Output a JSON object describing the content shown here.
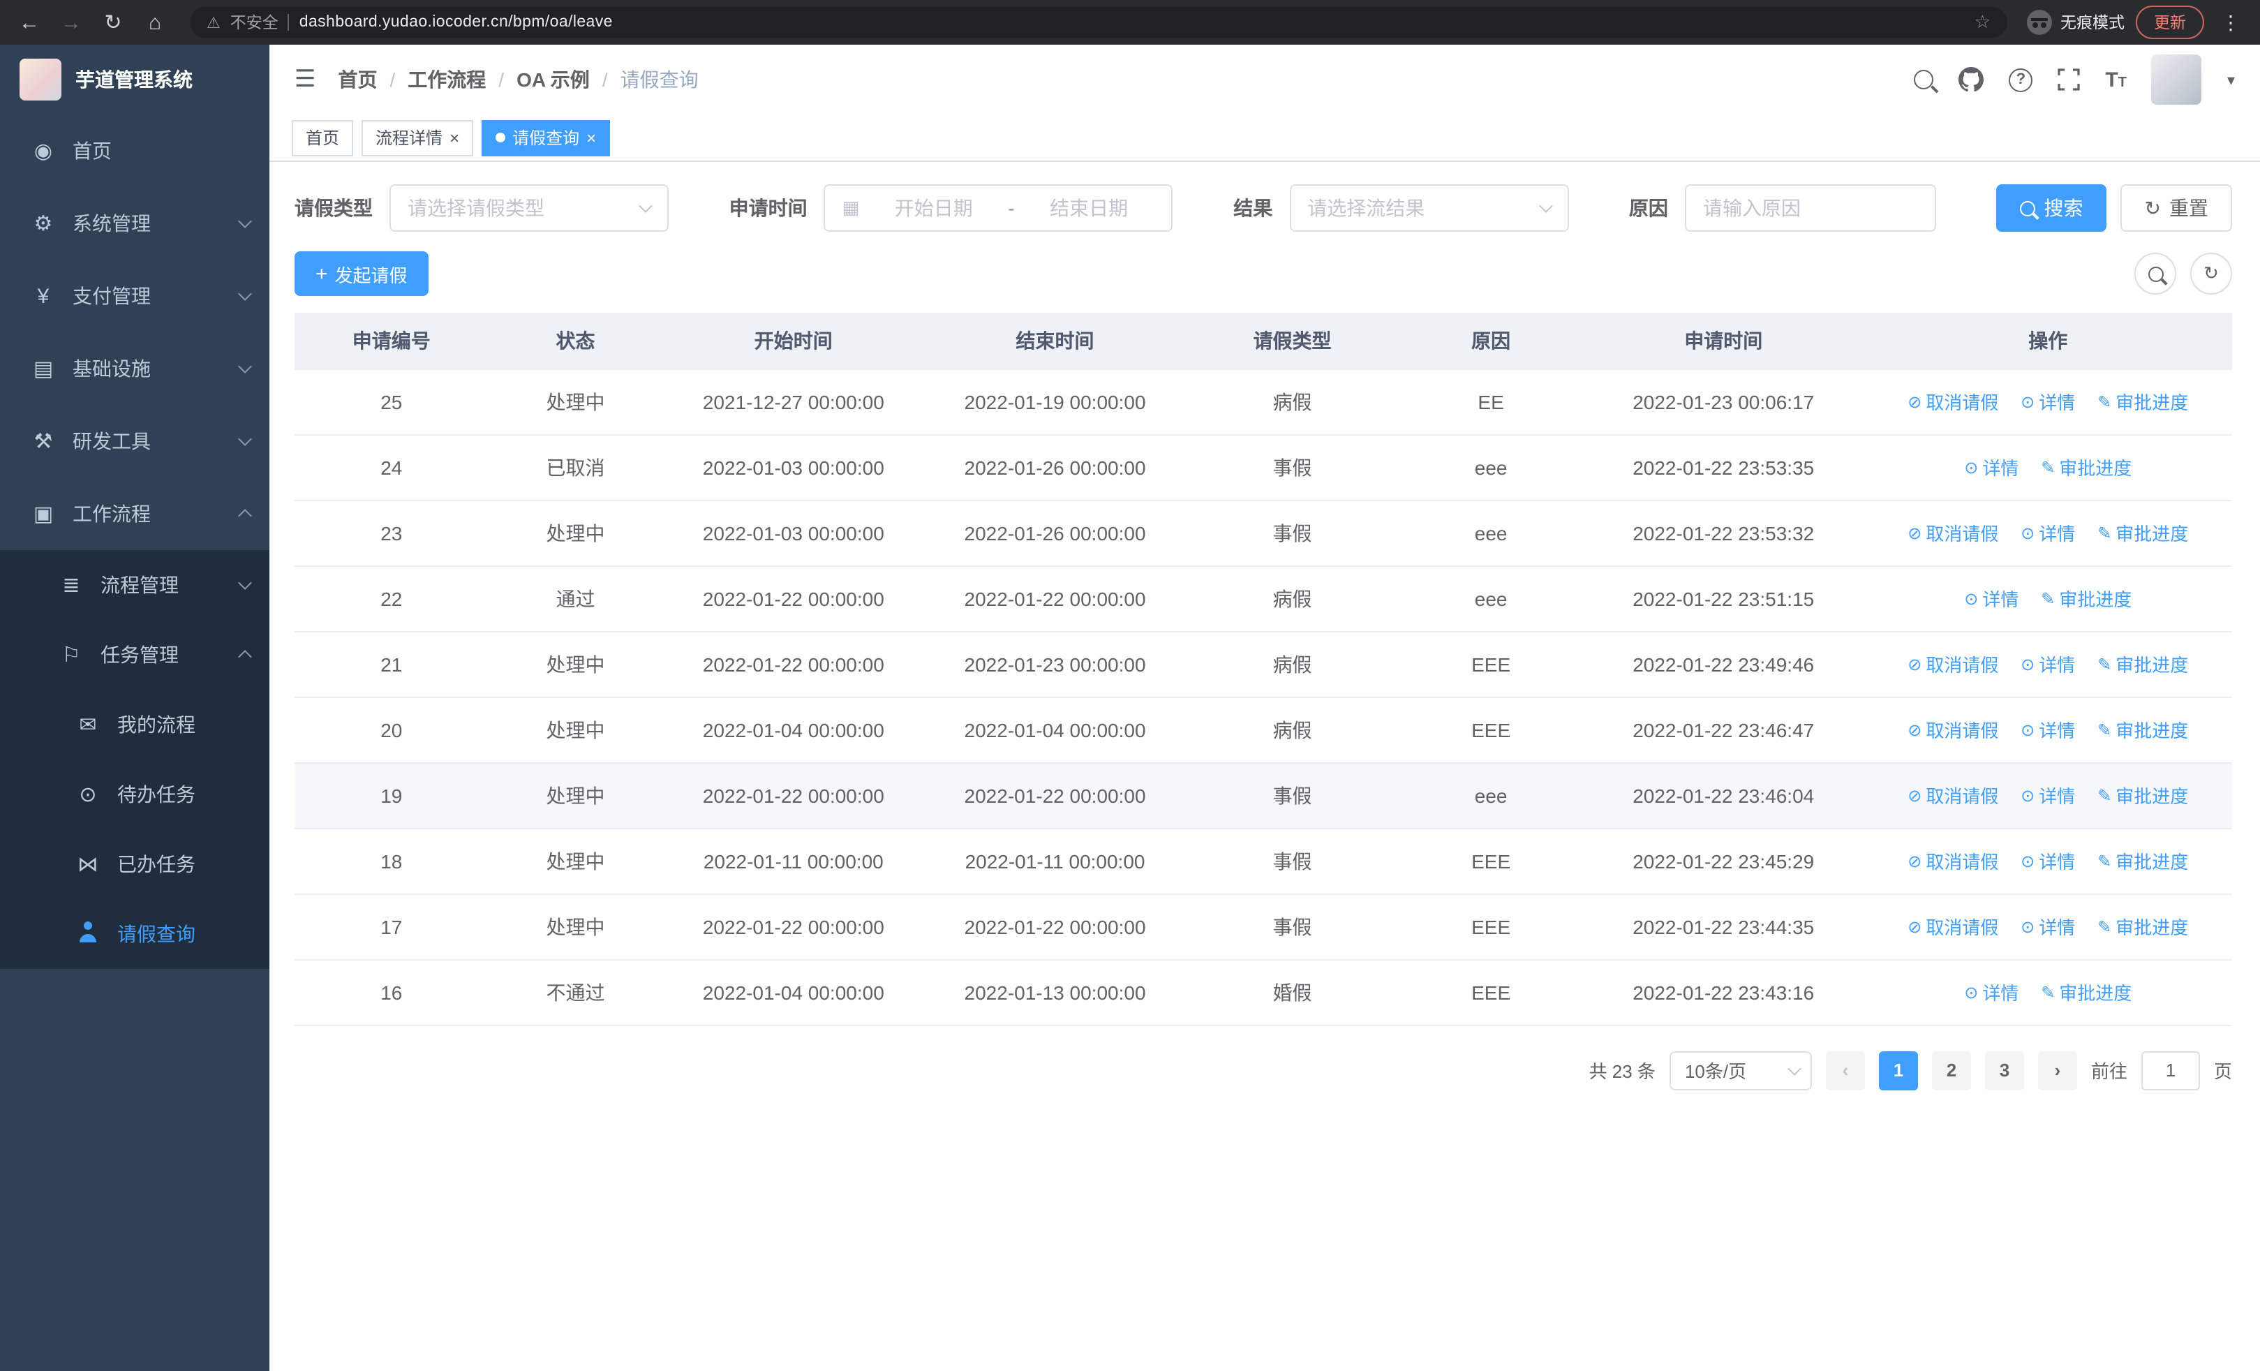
{
  "browser": {
    "security_label": "不安全",
    "url": "dashboard.yudao.iocoder.cn/bpm/oa/leave",
    "incognito_label": "无痕模式",
    "update_label": "更新"
  },
  "icons": {
    "back": "←",
    "forward": "→",
    "reload": "↻",
    "home": "⌂",
    "warning": "⚠",
    "star": "☆",
    "kebab": "⋮",
    "collapse": "☰",
    "question": "?",
    "font_large": "T",
    "font_small": "T",
    "caret": "▾",
    "close": "×",
    "plus": "+",
    "refresh": "↻",
    "calendar": "▦",
    "menu_dashboard": "◉",
    "menu_system": "⚙",
    "menu_payment": "¥",
    "menu_infra": "▤",
    "menu_devtools": "⚒",
    "menu_workflow": "▣",
    "menu_process": "≣",
    "menu_task": "⚐",
    "menu_my_process": "✉",
    "menu_todo": "⊙",
    "menu_done": "⋈",
    "op_cancel": "⊘",
    "op_detail": "⊙",
    "op_progress": "✎"
  },
  "sidebar": {
    "title": "芋道管理系统",
    "items": [
      {
        "label": "首页"
      },
      {
        "label": "系统管理"
      },
      {
        "label": "支付管理"
      },
      {
        "label": "基础设施"
      },
      {
        "label": "研发工具"
      },
      {
        "label": "工作流程"
      }
    ],
    "workflow_children": [
      {
        "label": "流程管理"
      },
      {
        "label": "任务管理"
      }
    ],
    "task_children": [
      {
        "label": "我的流程"
      },
      {
        "label": "待办任务"
      },
      {
        "label": "已办任务"
      },
      {
        "label": "请假查询"
      }
    ]
  },
  "header": {
    "breadcrumb": [
      "首页",
      "工作流程",
      "OA 示例",
      "请假查询"
    ],
    "separator": "/"
  },
  "tabs": [
    {
      "label": "首页"
    },
    {
      "label": "流程详情"
    },
    {
      "label": "请假查询"
    }
  ],
  "filters": {
    "leave_type_label": "请假类型",
    "leave_type_placeholder": "请选择请假类型",
    "apply_time_label": "申请时间",
    "start_date_placeholder": "开始日期",
    "date_separator": "-",
    "end_date_placeholder": "结束日期",
    "result_label": "结果",
    "result_placeholder": "请选择流结果",
    "reason_label": "原因",
    "reason_placeholder": "请输入原因",
    "search_button": "搜索",
    "reset_button": "重置"
  },
  "toolbar": {
    "create_button": "发起请假"
  },
  "table": {
    "columns": [
      "申请编号",
      "状态",
      "开始时间",
      "结束时间",
      "请假类型",
      "原因",
      "申请时间",
      "操作"
    ],
    "actions": {
      "cancel": "取消请假",
      "detail": "详情",
      "progress": "审批进度"
    },
    "rows": [
      {
        "id": "25",
        "status": "处理中",
        "start": "2021-12-27 00:00:00",
        "end": "2022-01-19 00:00:00",
        "type": "病假",
        "reason": "EE",
        "applied": "2022-01-23 00:06:17"
      },
      {
        "id": "24",
        "status": "已取消",
        "start": "2022-01-03 00:00:00",
        "end": "2022-01-26 00:00:00",
        "type": "事假",
        "reason": "eee",
        "applied": "2022-01-22 23:53:35"
      },
      {
        "id": "23",
        "status": "处理中",
        "start": "2022-01-03 00:00:00",
        "end": "2022-01-26 00:00:00",
        "type": "事假",
        "reason": "eee",
        "applied": "2022-01-22 23:53:32"
      },
      {
        "id": "22",
        "status": "通过",
        "start": "2022-01-22 00:00:00",
        "end": "2022-01-22 00:00:00",
        "type": "病假",
        "reason": "eee",
        "applied": "2022-01-22 23:51:15"
      },
      {
        "id": "21",
        "status": "处理中",
        "start": "2022-01-22 00:00:00",
        "end": "2022-01-23 00:00:00",
        "type": "病假",
        "reason": "EEE",
        "applied": "2022-01-22 23:49:46"
      },
      {
        "id": "20",
        "status": "处理中",
        "start": "2022-01-04 00:00:00",
        "end": "2022-01-04 00:00:00",
        "type": "病假",
        "reason": "EEE",
        "applied": "2022-01-22 23:46:47"
      },
      {
        "id": "19",
        "status": "处理中",
        "start": "2022-01-22 00:00:00",
        "end": "2022-01-22 00:00:00",
        "type": "事假",
        "reason": "eee",
        "applied": "2022-01-22 23:46:04"
      },
      {
        "id": "18",
        "status": "处理中",
        "start": "2022-01-11 00:00:00",
        "end": "2022-01-11 00:00:00",
        "type": "事假",
        "reason": "EEE",
        "applied": "2022-01-22 23:45:29"
      },
      {
        "id": "17",
        "status": "处理中",
        "start": "2022-01-22 00:00:00",
        "end": "2022-01-22 00:00:00",
        "type": "事假",
        "reason": "EEE",
        "applied": "2022-01-22 23:44:35"
      },
      {
        "id": "16",
        "status": "不通过",
        "start": "2022-01-04 00:00:00",
        "end": "2022-01-13 00:00:00",
        "type": "婚假",
        "reason": "EEE",
        "applied": "2022-01-22 23:43:16"
      }
    ]
  },
  "pagination": {
    "total": "共 23 条",
    "page_size": "10条/页",
    "prev": "‹",
    "next": "›",
    "pages": [
      "1",
      "2",
      "3"
    ],
    "goto_label": "前往",
    "goto_value": "1",
    "goto_suffix": "页"
  }
}
